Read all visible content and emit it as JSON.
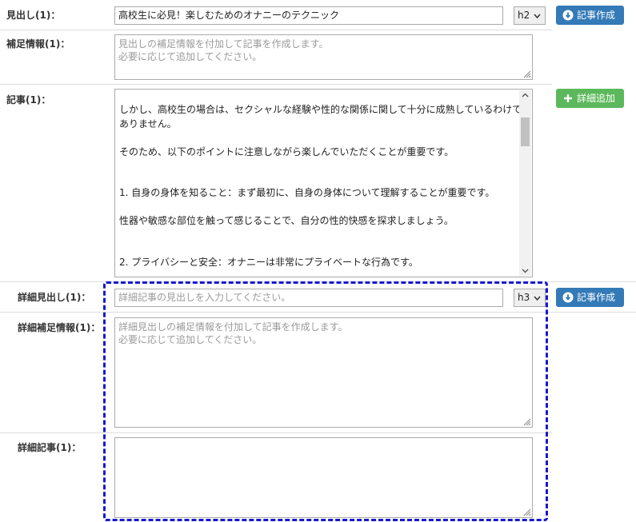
{
  "heading": {
    "label": "見出し(1)：",
    "value": "高校生に必見！楽しむためのオナニーのテクニック",
    "level": "h2",
    "create_button": "記事作成"
  },
  "supplement": {
    "label": "補足情報(1)：",
    "placeholder_line1": "見出しの補足情報を付加して記事を作成します。",
    "placeholder_line2": "必要に応じて追加してください。"
  },
  "article": {
    "label": "記事(1)：",
    "add_detail_button": "詳細追加",
    "lines": [
      "しかし、高校生の場合は、セクシャルな経験や性的な関係に関して十分に成熟しているわけでは",
      "ありません。",
      "そのため、以下のポイントに注意しながら楽しんでいただくことが重要です。",
      "1. 自身の身体を知ること：まず最初に、自身の身体について理解することが重要です。",
      "性器や敏感な部位を触って感じることで、自分の性的快感を探求しましょう。",
      "2. プライバシーと安全：オナニーは非常にプライベートな行為です。"
    ]
  },
  "detail_heading": {
    "label": "詳細見出し(1)：",
    "placeholder": "詳細記事の見出しを入力してください。",
    "level": "h3",
    "create_button": "記事作成"
  },
  "detail_supplement": {
    "label": "詳細補足情報(1)：",
    "placeholder_line1": "詳細見出しの補足情報を付加して記事を作成します。",
    "placeholder_line2": "必要に応じて追加してください。"
  },
  "detail_article": {
    "label": "詳細記事(1)："
  },
  "colors": {
    "primary_button": "#337ab7",
    "success_button": "#5cb85c",
    "highlight_border": "#1818d0"
  }
}
